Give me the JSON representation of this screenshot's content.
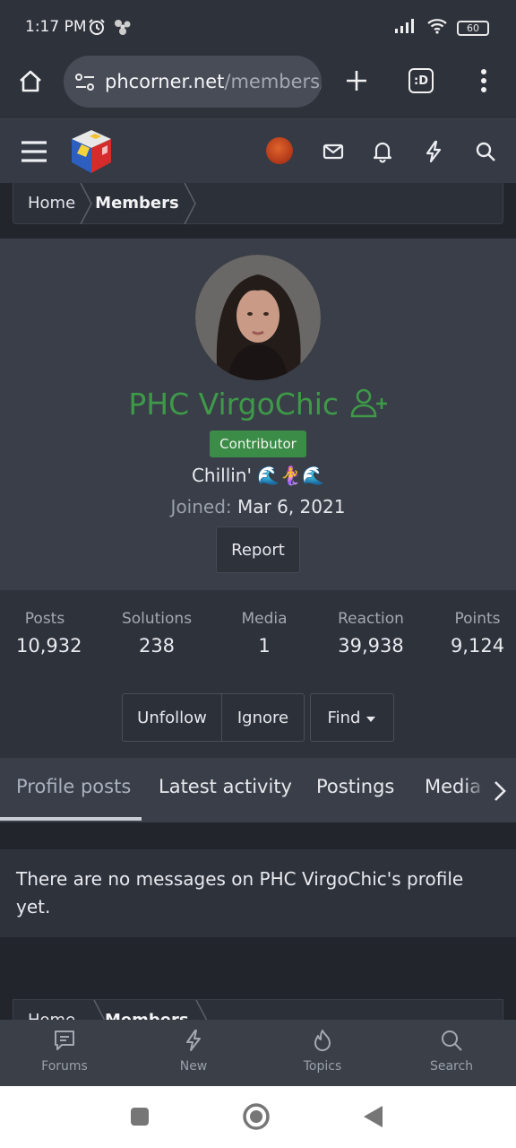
{
  "status": {
    "time": "1:17 PM",
    "battery": "60"
  },
  "browser": {
    "url_host": "phcorner.net",
    "url_path": "/members/",
    "tab_count": ":D"
  },
  "breadcrumb": {
    "items": [
      "Home",
      "Members"
    ]
  },
  "profile": {
    "username": "PHC VirgoChic",
    "badge": "Contributor",
    "custom_title": "Chillin' 🌊🧜‍♀️🌊",
    "joined_label": "Joined:",
    "joined_date": "Mar 6, 2021",
    "report_label": "Report"
  },
  "stats": [
    {
      "label": "Posts",
      "value": "10,932"
    },
    {
      "label": "Solutions",
      "value": "238"
    },
    {
      "label": "Media",
      "value": "1"
    },
    {
      "label": "Reaction",
      "value": "39,938"
    },
    {
      "label": "Points",
      "value": "9,124"
    }
  ],
  "actions": {
    "unfollow": "Unfollow",
    "ignore": "Ignore",
    "find": "Find"
  },
  "tabs": [
    "Profile posts",
    "Latest activity",
    "Postings",
    "Media"
  ],
  "message": "There are no messages on PHC VirgoChic's profile yet.",
  "bottom_nav": [
    "Forums",
    "New",
    "Topics",
    "Search"
  ],
  "colors": {
    "username": "#3e9a48",
    "badge": "#3a8c47"
  }
}
